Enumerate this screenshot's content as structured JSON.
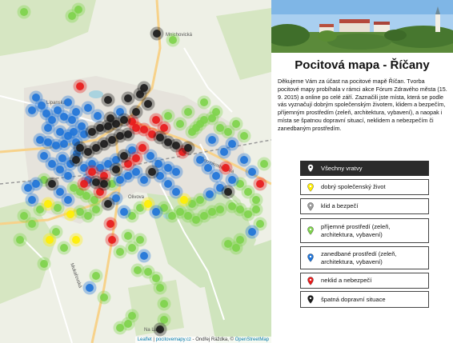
{
  "map": {
    "attribution": {
      "leaflet": "Leaflet",
      "sep1": " | ",
      "site": "pocitovemapy.cz",
      "sep2": " - Ondřej Ráždka, © ",
      "osm": "OpenStreetMap"
    },
    "road_labels": {
      "mnichovicka": "Mnichovická",
      "lipanska": "Lipanská",
      "na_lada": "Na Ladě",
      "mukarovska": "Mukařovská",
      "cernokostelecka": "Černokostelecká",
      "olivova": "Olivova"
    },
    "marker_colors": {
      "dobry_spolecensky_zivot": "#ffee00",
      "klid_a_bezpeci": "#9a9a9a",
      "prijemne_prostredi": "#7dd34a",
      "zanedbane_prostredi": "#1e73d8",
      "neklid_a_nebezpeci": "#e81818",
      "spatna_dopravni_situace": "#1a1a1a"
    }
  },
  "panel": {
    "title": "Pocitová mapa - Říčany",
    "description": "Děkujeme Vám za účast na pocitové mapě Říčan. Tvorba pocitové mapy probíhala v rámci akce Fórum Zdravého města (15. 9. 2015) a online po celé září. Zaznačili jste místa, která se podle vás vyznačují dobrým společenským životem, klidem a bezpečím, příjemným prostředím (zeleň, architektura, vybavení), a naopak i místa se špatnou dopravní situací, neklidem a nebezpečím či zanedbaným prostředím.",
    "filters": [
      {
        "label": "Všechny vratvy",
        "color": "#ffffff",
        "active": true
      },
      {
        "label": "dobrý společenský život",
        "color": "#ffee00",
        "active": false
      },
      {
        "label": "klid a bezpečí",
        "color": "#9a9a9a",
        "active": false
      },
      {
        "label": "příjemné prostředí (zeleň, architektura, vybavení)",
        "color": "#7dd34a",
        "active": false
      },
      {
        "label": "zanedbané prostředí (zeleň, architektura, vybavení)",
        "color": "#1e73d8",
        "active": false
      },
      {
        "label": "neklid a nebezpečí",
        "color": "#e81818",
        "active": false
      },
      {
        "label": "špatná dopravní situace",
        "color": "#1a1a1a",
        "active": false
      }
    ]
  }
}
